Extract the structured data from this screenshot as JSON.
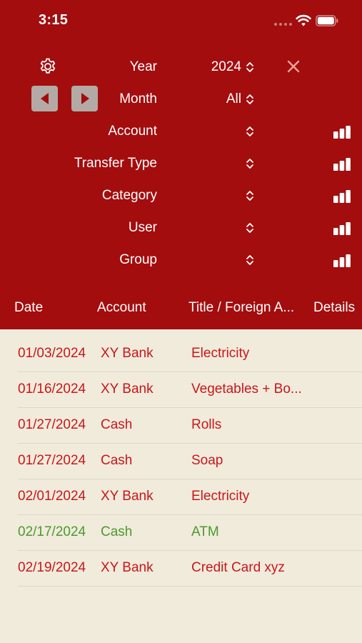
{
  "status_bar": {
    "time": "3:15"
  },
  "filters": {
    "year_label": "Year",
    "year_value": "2024",
    "month_label": "Month",
    "month_value": "All",
    "rows": [
      {
        "label": "Account",
        "value": ""
      },
      {
        "label": "Transfer Type",
        "value": ""
      },
      {
        "label": "Category",
        "value": ""
      },
      {
        "label": "User",
        "value": ""
      },
      {
        "label": "Group",
        "value": ""
      }
    ]
  },
  "table": {
    "columns": [
      "Date",
      "Account",
      "Title / Foreign A...",
      "Details"
    ],
    "rows": [
      {
        "date": "01/03/2024",
        "account": "XY Bank",
        "title": "Electricity",
        "kind": "expense"
      },
      {
        "date": "01/16/2024",
        "account": "XY Bank",
        "title": "Vegetables + Bo...",
        "kind": "expense"
      },
      {
        "date": "01/27/2024",
        "account": "Cash",
        "title": "Rolls",
        "kind": "expense"
      },
      {
        "date": "01/27/2024",
        "account": "Cash",
        "title": "Soap",
        "kind": "expense"
      },
      {
        "date": "02/01/2024",
        "account": "XY Bank",
        "title": "Electricity",
        "kind": "expense"
      },
      {
        "date": "02/17/2024",
        "account": "Cash",
        "title": "ATM",
        "kind": "transfer"
      },
      {
        "date": "02/19/2024",
        "account": "XY Bank",
        "title": "Credit Card xyz",
        "kind": "expense"
      }
    ]
  },
  "colors": {
    "header_bg": "#a30d0e",
    "list_bg": "#f1ebdc",
    "expense": "#c8171a",
    "transfer": "#4a9a2c",
    "close": "#f0a39c"
  },
  "icons": {
    "settings": "gear-icon",
    "close": "close-icon",
    "previous": "triangle-left-icon",
    "next": "triangle-right-icon",
    "picker": "chevron-up-down-icon",
    "chart": "bar-chart-icon"
  }
}
